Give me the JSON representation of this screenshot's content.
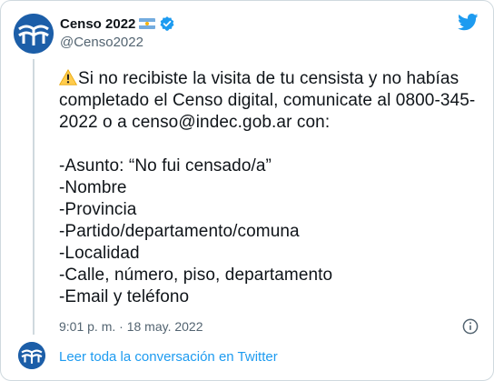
{
  "author": {
    "display_name": "Censo 2022",
    "handle": "@Censo2022",
    "avatar_icon": "censo-logo-icon",
    "flag_icon": "argentina-flag-icon",
    "verified_icon": "verified-badge-icon"
  },
  "tweet": {
    "intro": "Si no recibiste la visita de tu censista y no habías completado el Censo digital, comunicate al 0800-345-2022 o a censo@indec.gob.ar con:",
    "warning_icon": "warning-icon",
    "list": [
      "-Asunto: “No fui censado/a”",
      "-Nombre",
      "-Provincia",
      "-Partido/departamento/comuna",
      "-Localidad",
      "-Calle, número, piso, departamento",
      "-Email y teléfono"
    ],
    "timestamp": "9:01 p. m. · 18 may. 2022"
  },
  "footer": {
    "read_more": "Leer toda la conversación en Twitter"
  },
  "colors": {
    "accent": "#1d9bf0",
    "avatar_bg": "#1c5ea8",
    "secondary_text": "#536471",
    "border": "#cfd9de"
  }
}
